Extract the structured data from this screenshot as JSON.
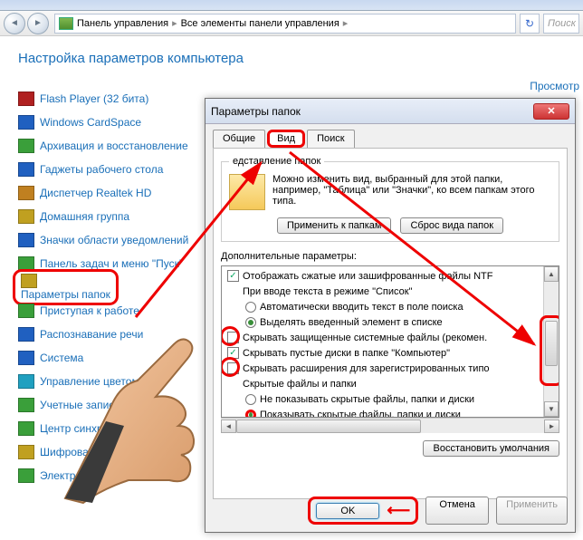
{
  "breadcrumb": {
    "seg1": "Панель управления",
    "seg2": "Все элементы панели управления",
    "search_ph": "Поиск"
  },
  "page_title": "Настройка параметров компьютера",
  "view_label": "Просмотр",
  "cpl_items": [
    {
      "label": "Flash Player (32 бита)",
      "color": "#b02020"
    },
    {
      "label": "Windows CardSpace",
      "color": "#2060c0"
    },
    {
      "label": "Архивация и восстановление",
      "color": "#3a9f3a"
    },
    {
      "label": "Гаджеты рабочего стола",
      "color": "#2060c0"
    },
    {
      "label": "Диспетчер Realtek HD",
      "color": "#c08020"
    },
    {
      "label": "Домашняя группа",
      "color": "#c0a020"
    },
    {
      "label": "Значки области уведомлений",
      "color": "#2060c0"
    },
    {
      "label": "Панель задач и меню \"Пуск\"",
      "color": "#3a9f3a"
    },
    {
      "label": "Параметры папок",
      "color": "#c0a020",
      "hl": true
    },
    {
      "label": "Приступая к работе",
      "color": "#3a9f3a"
    },
    {
      "label": "Распознавание речи",
      "color": "#2060c0"
    },
    {
      "label": "Система",
      "color": "#2060c0"
    },
    {
      "label": "Управление цветом",
      "color": "#20a0c0"
    },
    {
      "label": "Учетные записи и",
      "color": "#3a9f3a"
    },
    {
      "label": "Центр синхро",
      "color": "#3a9f3a"
    },
    {
      "label": "Шифрова",
      "color": "#c0a020"
    },
    {
      "label": "Электро",
      "color": "#3a9f3a"
    }
  ],
  "dialog": {
    "title": "Параметры папок",
    "tabs": {
      "general": "Общие",
      "view": "Вид",
      "search": "Поиск"
    },
    "fs_legend": "едставление папок",
    "fs_text": "Можно изменить вид, выбранный для этой папки, например, \"Таблица\" или \"Значки\", ко всем папкам этого типа.",
    "btn_apply_folders": "Применить к папкам",
    "btn_reset_folders": "Сброс вида папок",
    "adv_label": "Дополнительные параметры:",
    "tree": {
      "r0": "Отображать сжатые или зашифрованные файлы NTF",
      "r1": "При вводе текста в режиме \"Список\"",
      "r2": "Автоматически вводить текст в поле поиска",
      "r3": "Выделять введенный элемент в списке",
      "r4": "Скрывать защищенные системные файлы (рекомен.",
      "r5": "Скрывать пустые диски в папке \"Компьютер\"",
      "r6": "Скрывать расширения для зарегистрированных типо",
      "r7": "Скрытые файлы и папки",
      "r8": "Не показывать скрытые файлы, папки и диски",
      "r9": "Показывать скрытые файлы, папки и диски"
    },
    "btn_restore": "Восстановить умолчания",
    "btn_ok": "OK",
    "btn_cancel": "Отмена",
    "btn_apply": "Применить"
  }
}
